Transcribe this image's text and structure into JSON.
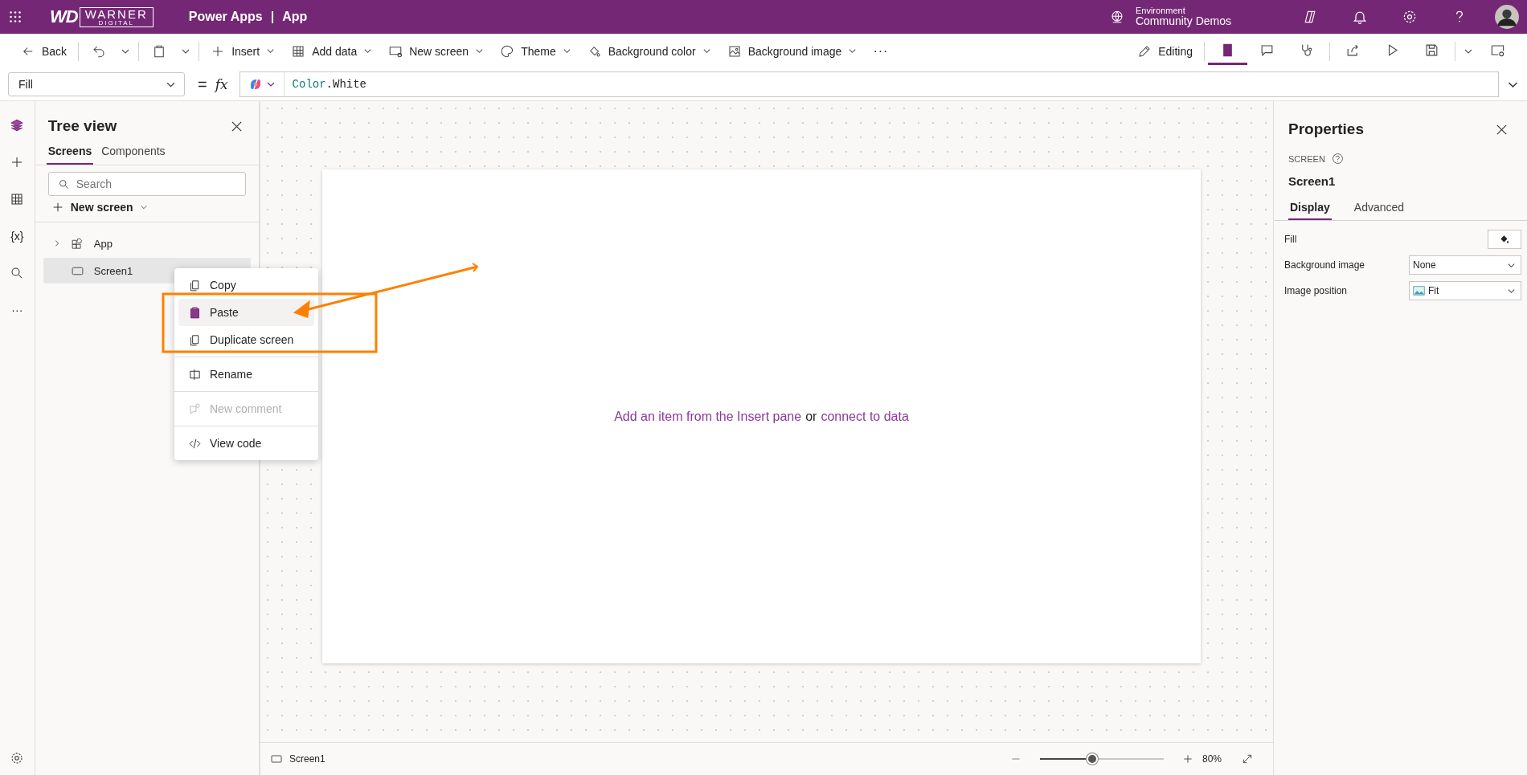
{
  "header": {
    "logo_mark": "WD",
    "logo_name": "WARNER",
    "logo_sub": "DIGITAL",
    "product": "Power Apps",
    "separator": "|",
    "app": "App",
    "environment_label": "Environment",
    "environment": "Community Demos"
  },
  "toolbar": {
    "left_groups": [
      [
        {
          "kind": "labeled",
          "label": "Back"
        }
      ],
      [
        {
          "kind": "icon"
        },
        {
          "kind": "caret"
        }
      ],
      [
        {
          "kind": "icon"
        },
        {
          "kind": "caret"
        }
      ],
      [
        {
          "kind": "labeled",
          "label": "Insert",
          "caret": true
        },
        {
          "kind": "labeled",
          "label": "Add data",
          "caret": true
        },
        {
          "kind": "labeled",
          "label": "New screen",
          "caret": true
        },
        {
          "kind": "labeled",
          "label": "Theme",
          "caret": true
        },
        {
          "kind": "labeled",
          "label": "Background color",
          "caret": true
        },
        {
          "kind": "labeled",
          "label": "Background image",
          "caret": true
        },
        {
          "kind": "more",
          "label": "···"
        }
      ]
    ],
    "right_groups": [
      [
        {
          "kind": "labeled",
          "label": "Editing"
        }
      ],
      [
        {
          "kind": "icon",
          "selected": true
        },
        {
          "kind": "icon",
          "selected": false
        },
        {
          "kind": "icon",
          "selected": false
        }
      ],
      [
        {
          "kind": "icon"
        },
        {
          "kind": "icon"
        },
        {
          "kind": "icon"
        }
      ],
      [
        {
          "kind": "caret"
        },
        {
          "kind": "icon"
        }
      ]
    ]
  },
  "formula_bar": {
    "property": "Fill",
    "equals": "=",
    "fx": "fx",
    "tokens": [
      {
        "kind": "enum",
        "text": "Color"
      },
      {
        "kind": "plain",
        "text": ".White"
      }
    ]
  },
  "rail": [
    {
      "selected": true
    },
    {
      "selected": false
    },
    {
      "selected": false
    },
    {
      "selected": false,
      "glyph": "{x}"
    },
    {
      "selected": false
    },
    {
      "selected": false,
      "glyph": "···"
    }
  ],
  "tree_view": {
    "title": "Tree view",
    "tabs": [
      {
        "label": "Screens",
        "selected": true
      },
      {
        "label": "Components",
        "selected": false
      }
    ],
    "search": {
      "placeholder": "Search"
    },
    "new_screen": "New screen",
    "nodes": [
      {
        "label": "App",
        "kind": "app",
        "expanded": false,
        "selected": false
      },
      {
        "label": "Screen1",
        "kind": "screen",
        "selected": true
      }
    ]
  },
  "context_menu": {
    "groups": [
      [
        {
          "label": "Copy",
          "hovered": false,
          "disabled": false
        },
        {
          "label": "Paste",
          "hovered": true,
          "disabled": false
        },
        {
          "label": "Duplicate screen",
          "hovered": false,
          "disabled": false
        }
      ],
      [
        {
          "label": "Rename",
          "hovered": false,
          "disabled": false
        }
      ],
      [
        {
          "label": "New comment",
          "hovered": false,
          "disabled": true
        }
      ],
      [
        {
          "label": "View code",
          "hovered": false,
          "disabled": false
        }
      ]
    ]
  },
  "canvas": {
    "hint": "Add an item from the Insert pane",
    "joiner": "or",
    "link": "connect to data"
  },
  "status_bar": {
    "screen": "Screen1",
    "zoom": {
      "level": 0.42
    },
    "zoom_reading": "80%"
  },
  "properties": {
    "title": "Properties",
    "type_label": "SCREEN",
    "name": "Screen1",
    "tabs": [
      {
        "label": "Display",
        "selected": true
      },
      {
        "label": "Advanced",
        "selected": false
      }
    ],
    "rows": [
      {
        "label": "Fill",
        "kind": "color"
      },
      {
        "label": "Background image",
        "kind": "dropdown",
        "value": "None"
      },
      {
        "label": "Image position",
        "kind": "dropdown",
        "value": "Fit",
        "image": true
      }
    ]
  }
}
